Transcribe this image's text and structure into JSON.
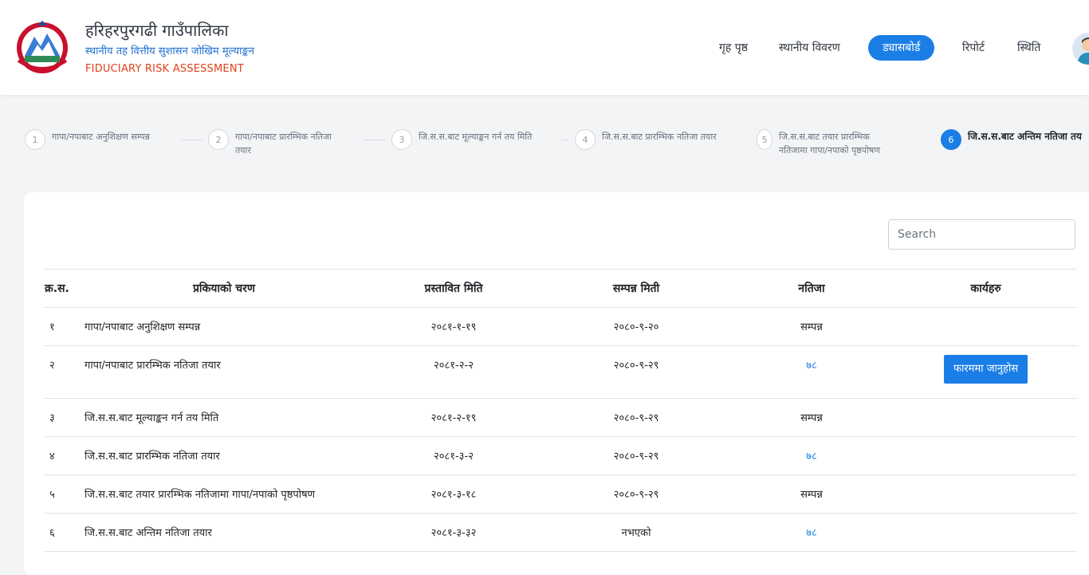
{
  "header": {
    "title": "हरिहरपुरगढी गाउँपालिका",
    "subtitle": "स्थानीय तह वित्तीय सुशासन जोखिम मूल्याङ्कन",
    "english": "FIDUCIARY RISK ASSESSMENT",
    "nav": [
      "गृह पृष्ठ",
      "स्थानीय विवरण",
      "ड्यासबोर्ड",
      "रिपोर्ट",
      "स्थिति"
    ],
    "active_nav": "ड्यासबोर्ड"
  },
  "steps": [
    {
      "num": "1",
      "label": "गापा/नपाबाट अनुशिक्षण सम्पन्न"
    },
    {
      "num": "2",
      "label_lines": [
        "गापा/नपाबाट प्रारम्भिक नतिजा",
        "तयार"
      ]
    },
    {
      "num": "3",
      "label": "जि.स.स.बाट मूल्याङ्कन गर्न तय मिति"
    },
    {
      "num": "4",
      "label": "जि.स.स.बाट प्रारम्भिक नतिजा तयार"
    },
    {
      "num": "5",
      "label_lines": [
        "जि.स.स.बाट तयार प्रारम्भिक",
        "नतिजामा गापा/नपाको पृष्ठपोषण"
      ]
    },
    {
      "num": "6",
      "label": "जि.स.स.बाट अन्तिम नतिजा तय"
    }
  ],
  "search": {
    "placeholder": "Search"
  },
  "table": {
    "headers": [
      "क्र.स.",
      "प्रकियाको चरण",
      "प्रस्तावित मिति",
      "सम्पन्न मिती",
      "नतिजा",
      "कार्यहरु"
    ],
    "rows": [
      {
        "sn": "१",
        "step": "गापा/नपाबाट अनुशिक्षण सम्पन्न",
        "proposed": "२०८१-१-१९",
        "completed": "२०८०-९-२०",
        "result": "सम्पन्न",
        "action": ""
      },
      {
        "sn": "२",
        "step": "गापा/नपाबाट प्रारम्भिक नतिजा तयार",
        "proposed": "२०८१-२-२",
        "completed": "२०८०-९-२९",
        "result": "७८",
        "action": "फारममा जानुहोस"
      },
      {
        "sn": "३",
        "step": "जि.स.स.बाट मूल्याङ्कन गर्न तय मिति",
        "proposed": "२०८१-२-१९",
        "completed": "२०८०-९-२९",
        "result": "सम्पन्न",
        "action": ""
      },
      {
        "sn": "४",
        "step": "जि.स.स.बाट प्रारम्भिक नतिजा तयार",
        "proposed": "२०८१-३-२",
        "completed": "२०८०-९-२९",
        "result": "७८",
        "action": ""
      },
      {
        "sn": "५",
        "step": "जि.स.स.बाट तयार प्रारम्भिक नतिजामा गापा/नपाको पृष्ठपोषण",
        "proposed": "२०८१-३-१८",
        "completed": "२०८०-९-२९",
        "result": "सम्पन्न",
        "action": ""
      },
      {
        "sn": "६",
        "step": "जि.स.स.बाट अन्तिम नतिजा तयार",
        "proposed": "२०८१-३-३२",
        "completed": "नभएको",
        "result": "७८",
        "action": ""
      }
    ]
  },
  "colors": {
    "accent": "#1a7ee6",
    "brand_red": "#e0411b",
    "subtitle_blue": "#1f6fd1"
  }
}
